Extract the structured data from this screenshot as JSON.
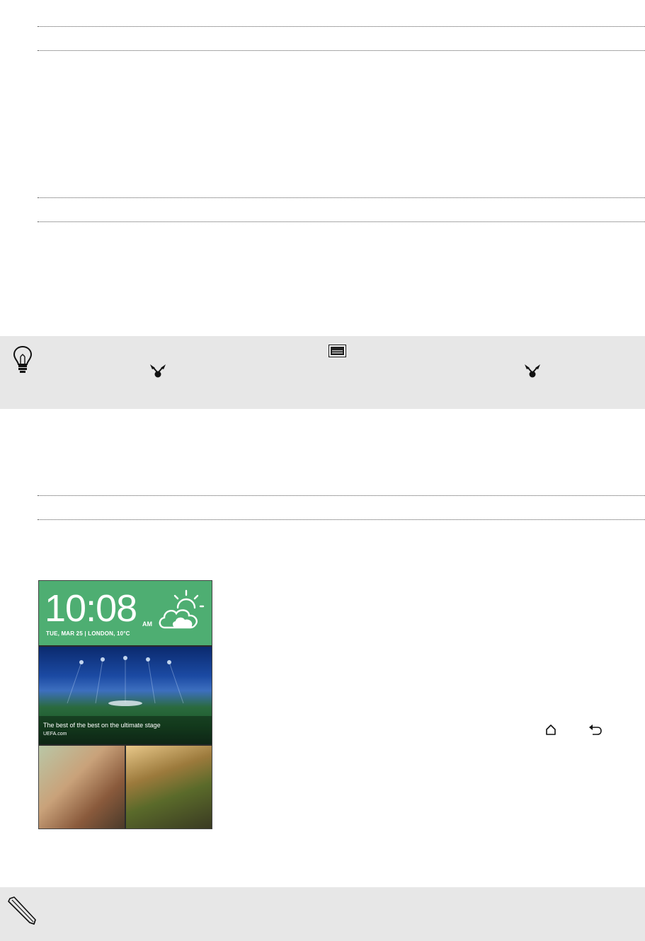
{
  "phone": {
    "clock": {
      "time": "10:08",
      "ampm": "AM",
      "date": "TUE, MAR 25 | LONDON, 10°C"
    },
    "news": {
      "caption": "The best of the best on the ultimate stage",
      "source": "UEFA.com"
    },
    "weather_icon": "partly-cloudy-icon"
  },
  "icons": {
    "tip": "lightbulb-icon",
    "screenshot": "screenshot-icon",
    "share_1": "share-icon",
    "share_2": "share-icon",
    "home": "home-icon",
    "back": "back-icon",
    "note": "pencil-icon"
  }
}
